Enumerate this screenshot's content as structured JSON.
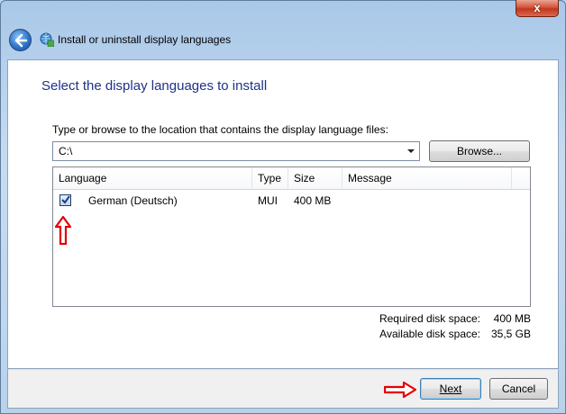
{
  "window": {
    "title": "Install or uninstall display languages",
    "close_glyph": "x"
  },
  "page": {
    "heading": "Select the display languages to install",
    "location_prompt": "Type or browse to the location that contains the display language files:",
    "location_value": "C:\\",
    "browse_label": "Browse..."
  },
  "list": {
    "columns": [
      "Language",
      "Type",
      "Size",
      "Message"
    ],
    "rows": [
      {
        "checked": true,
        "language": "German (Deutsch)",
        "type": "MUI",
        "size": "400 MB",
        "message": ""
      }
    ]
  },
  "disk": {
    "required_label": "Required disk space:",
    "required_value": "400 MB",
    "available_label": "Available disk space:",
    "available_value": "35,5 GB"
  },
  "buttons": {
    "next_label": "Next",
    "cancel_label": "Cancel"
  },
  "icons": {
    "back": "back-arrow-icon",
    "title": "globe-language-icon",
    "close": "close-icon",
    "annotation_up": "red-arrow-up-icon",
    "annotation_right": "red-arrow-right-icon"
  },
  "colors": {
    "heading": "#1e3287",
    "annotation": "#e30000",
    "frame": "#b9d2ec"
  }
}
